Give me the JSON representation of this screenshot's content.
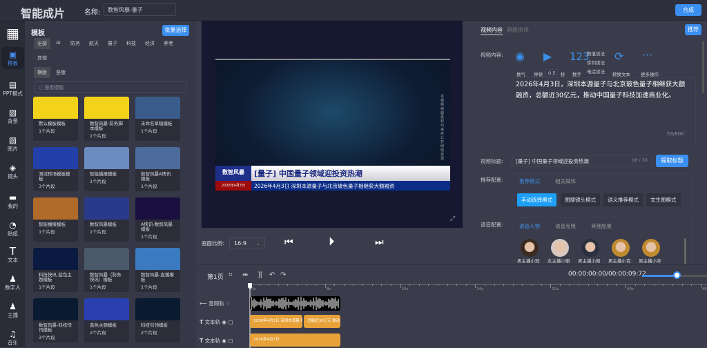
{
  "header": {
    "title": "智能成片",
    "name_label": "名称:",
    "name_value": "数智风暴-量子",
    "compose_label": "合成"
  },
  "sidebar": {
    "items": [
      {
        "label": "模板",
        "icon": "template-icon"
      },
      {
        "label": "PPT模式",
        "icon": "ppt-icon"
      },
      {
        "label": "背景",
        "icon": "background-icon"
      },
      {
        "label": "图片",
        "icon": "image-icon"
      },
      {
        "label": "镜头",
        "icon": "layers-icon"
      },
      {
        "label": "我的",
        "icon": "folder-icon"
      },
      {
        "label": "贴纸",
        "icon": "sticker-icon"
      },
      {
        "label": "文本",
        "icon": "text-icon"
      },
      {
        "label": "数字人",
        "icon": "person-icon"
      },
      {
        "label": "主播",
        "icon": "anchor-icon"
      },
      {
        "label": "音乐",
        "icon": "music-icon"
      }
    ]
  },
  "templates": {
    "title": "模板",
    "batch_label": "批量选择",
    "categories": [
      "全部",
      "AI",
      "防务",
      "航天",
      "量子",
      "科技",
      "经济",
      "养老",
      "其他"
    ],
    "orientations": [
      "横版",
      "竖版"
    ],
    "search_placeholder": "搜索模版",
    "items": [
      {
        "name": "默认模板模板",
        "count": "1个片段"
      },
      {
        "name": "数智风暴-防务脚本模板",
        "count": "1个片段"
      },
      {
        "name": "未命名草稿模板",
        "count": "1个片段"
      },
      {
        "name": "测试转场模板模板",
        "count": "3个片段"
      },
      {
        "name": "智能播报模板",
        "count": "1个片段"
      },
      {
        "name": "数智风暴A快讯模板",
        "count": "1个片段"
      },
      {
        "name": "智能播报模板",
        "count": "1个片段"
      },
      {
        "name": "数智风暴模板",
        "count": "1个片段"
      },
      {
        "name": "A快讯-数智风暴模板",
        "count": "1个片段"
      },
      {
        "name": "科技快讯-蓝色主题模板",
        "count": "1个片段"
      },
      {
        "name": "数智风暴（防务快讯）模板",
        "count": "1个片段"
      },
      {
        "name": "数智风暴-直播模板",
        "count": "1个片段"
      },
      {
        "name": "数智风暴-科技快讯模板",
        "count": "3个片段"
      },
      {
        "name": "蓝色主题模板",
        "count": "2个片段"
      },
      {
        "name": "科技引领模板",
        "count": "2个片段"
      }
    ]
  },
  "preview": {
    "brand": "数智风暴",
    "headline": "[量子] 中国量子领域迎投资热潮",
    "date_box": "2026年4月7日",
    "ticker": "2026年4月3日  深圳本源量子与北京玻色量子相继获大额融资",
    "side_note": "本视频画面素材均来自公开网络资源",
    "ratio_label": "画面比例:",
    "ratio_value": "16:9"
  },
  "right": {
    "tabs": [
      "视频内容",
      "网络资讯"
    ],
    "recommend_label": "推荐",
    "content_label": "视频内容:",
    "tools": {
      "breath": "换气",
      "pause": "停顿",
      "pause_value": "0.5",
      "seconds": "秒",
      "number": "数字",
      "number_glyph": "123",
      "number_modes": [
        "数值读法",
        "序列读法",
        "电话读法"
      ],
      "convert": "转换文本",
      "more": "更多操作"
    },
    "content_text": "2026年4月3日，深圳本源量子与北京玻色量子相继获大额融资，总额近30亿元，推动中国量子科技加速商业化。",
    "content_count": "53/800",
    "title_label": "视频标题:",
    "title_value": "[量子] 中国量子领域迎投资热潮",
    "title_count": "16 / 30",
    "extract_label": "提取标题",
    "recommend_config_label": "推荐配置:",
    "recommend_tabs": [
      "推荐模式",
      "相关媒体"
    ],
    "modes": [
      "手动选择模式",
      "图搜镜头模式",
      "语义推荐模式",
      "文生图模式"
    ],
    "voice_label": "语音配置:",
    "voice_tabs": [
      "语音人物",
      "语音克隆",
      "其他配置"
    ],
    "voices": [
      "男主播小冠",
      "女主播小丽",
      "男主播小刚",
      "男主播小克",
      "男主播小泽"
    ]
  },
  "timeline": {
    "page_label": "第1页",
    "timecode": "00:00:00:00/00:00:09:72",
    "zoom_level": 0.5,
    "ticks": [
      "0s",
      "8s",
      "16s",
      "24s",
      "32s",
      "40s",
      "48s"
    ],
    "tracks": [
      {
        "label": "音频轨"
      },
      {
        "label": "文本轨",
        "clips": [
          "2026年4月3日 深圳本源量子!",
          "总额近30亿元 推动"
        ]
      },
      {
        "label": "文本轨",
        "clips": [
          "2026年4月7日"
        ]
      }
    ]
  },
  "colors": {
    "accent": "#3b8ff0",
    "clip": "#e7a23a",
    "active_mode": "#1ea0f6"
  }
}
